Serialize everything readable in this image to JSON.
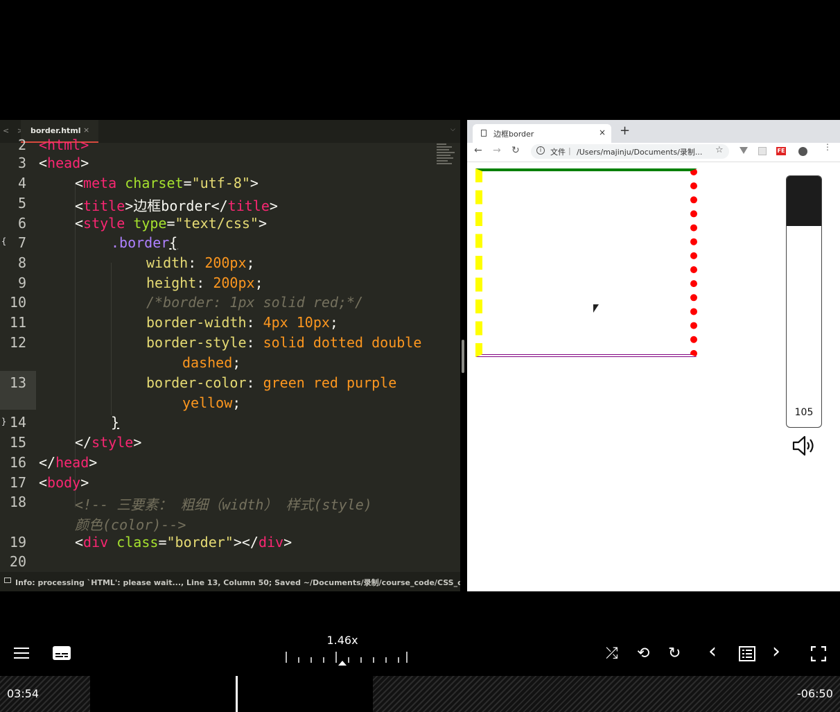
{
  "editor": {
    "tab_label": "border.html",
    "tab_close": "×",
    "nav_arrows": "< >",
    "tab_chevron": "⌵",
    "lines": {
      "n2": "2",
      "n3": "3",
      "n4": "4",
      "n5": "5",
      "n6": "6",
      "n7": "7",
      "n8": "8",
      "n9": "9",
      "n10": "10",
      "n11": "11",
      "n12": "12",
      "n13": "13",
      "n14": "14",
      "n15": "15",
      "n16": "16",
      "n17": "17",
      "n18": "18",
      "n19": "19",
      "n20": "20"
    },
    "code": {
      "l2_html": "<html>",
      "l3_head": "head",
      "l4_meta": "meta",
      "l4_charset": "charset",
      "l4_val": "\"utf-8\"",
      "l5_title": "title",
      "l5_text": "边框border",
      "l6_style": "style",
      "l6_type": "type",
      "l6_val": "\"text/css\"",
      "l7_sel": ".border",
      "l7_brace": "{",
      "l8_prop": "width",
      "l8_val": "200px",
      "l9_prop": "height",
      "l9_val": "200px",
      "l10_comment": "/*border: 1px solid red;*/",
      "l11_prop": "border-width",
      "l11_val": "4px 10px",
      "l12_prop": "border-style",
      "l12_val": "solid dotted double",
      "l12_wrap": "dashed",
      "l13_prop": "border-color",
      "l13_val": "green red purple",
      "l13_wrap": "yellow",
      "l14_brace": "}",
      "l15_style": "style",
      "l16_head": "head",
      "l17_body": "body",
      "l18_comment": "<!-- 三要素： 粗细（width） 样式(style)",
      "l18_wrap": "颜色(color)-->",
      "l19_div": "div",
      "l19_class": "class",
      "l19_val": "\"border\"",
      "l19_close": "div"
    },
    "status_text": "Info: processing `HTML': please wait..., Line 13, Column 50; Saved ~/Documents/录制/course_code/CSS_cod"
  },
  "browser": {
    "tab_title": "边框border",
    "tab_close": "×",
    "new_tab": "+",
    "back": "←",
    "forward": "→",
    "reload": "↻",
    "info_glyph": "i",
    "omnibox_file_label": "文件",
    "omnibox_sep": "|",
    "omnibox_url": "/Users/majinju/Documents/录制...",
    "star": "☆",
    "ext_badge": "FE",
    "kebab": "⋮"
  },
  "volume": {
    "value": "105",
    "level_fraction": 0.2
  },
  "player": {
    "speed_label": "1.46x",
    "time_elapsed": "03:54",
    "time_remaining": "-06:50",
    "glyphs": {
      "shuffle": "⤮",
      "repeat": "⟲",
      "repeat_one": "↻",
      "prev": "‹",
      "next": "›",
      "fullscreen": "⛶"
    }
  },
  "colors": {
    "editor_bg": "#272822",
    "tag": "#f92672",
    "attr": "#a6e22e",
    "string": "#e6db74",
    "property": "#66d9ef",
    "selector": "#ae81ff",
    "value": "#fd971f",
    "comment": "#75715e"
  }
}
